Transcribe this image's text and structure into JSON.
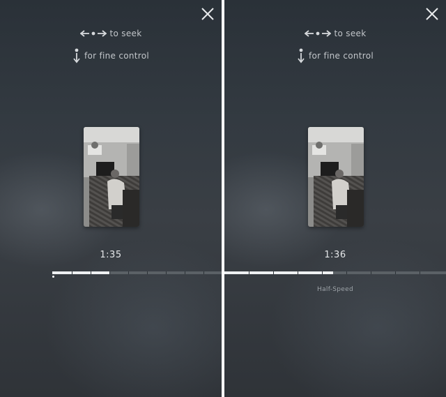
{
  "panels": [
    {
      "hint_seek": "to seek",
      "hint_fine": "for fine control",
      "timestamp": "1:35",
      "progress": 0.34,
      "mode_label": ""
    },
    {
      "hint_seek": "to seek",
      "hint_fine": "for fine control",
      "timestamp": "1:36",
      "progress": 0.49,
      "mode_label": "Half-Speed"
    }
  ],
  "icons": {
    "close": "close-icon",
    "seek": "arrows-left-right-icon",
    "fine": "arrow-down-icon"
  },
  "colors": {
    "background": "#333a41",
    "progress_fill": "#eef0f2",
    "progress_track": "#5b6166",
    "hint_text": "#c2c6ca"
  }
}
